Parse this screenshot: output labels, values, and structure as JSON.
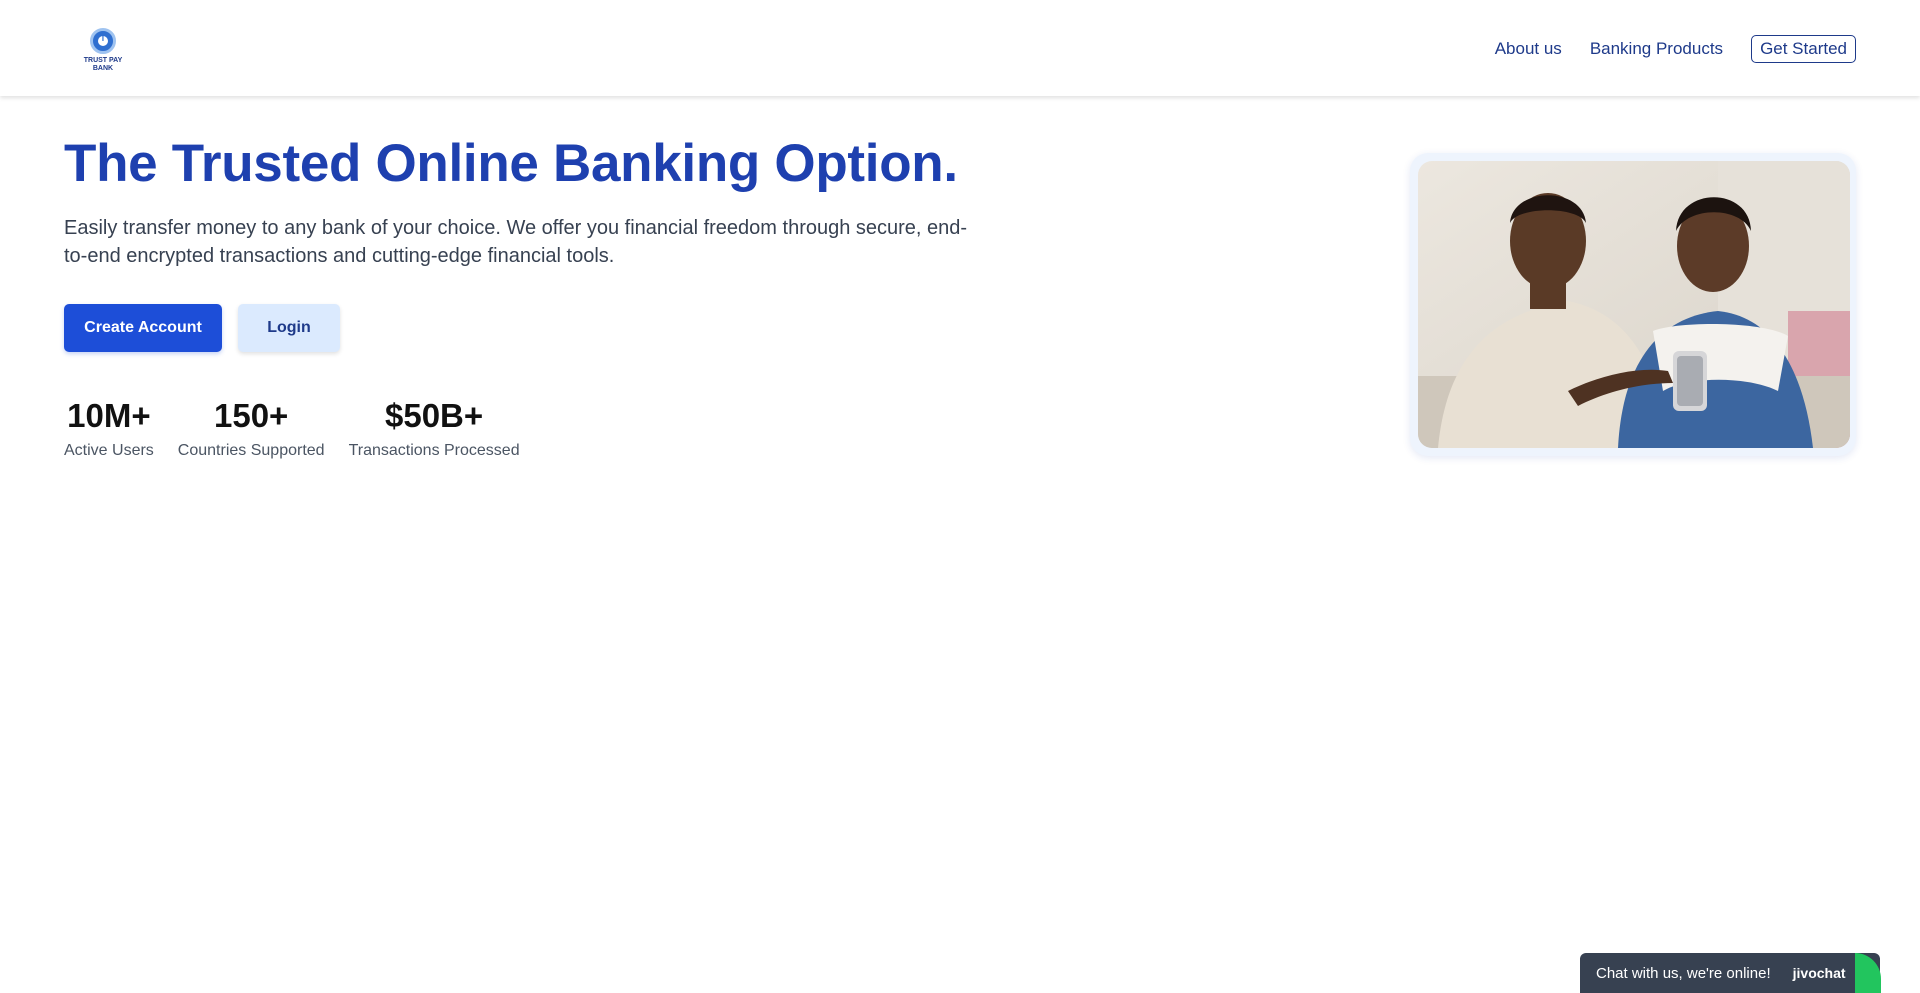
{
  "brand": {
    "name": "TRUST PAY BANK",
    "logo_letter": "T"
  },
  "nav": {
    "about": "About us",
    "products": "Banking Products",
    "get_started": "Get Started"
  },
  "hero": {
    "title": "The Trusted Online Banking Option.",
    "subtitle": "Easily transfer money to any bank of your choice. We offer you financial freedom through secure, end-to-end encrypted transactions and cutting-edge financial tools.",
    "primary_button": "Create Account",
    "secondary_button": "Login"
  },
  "stats": [
    {
      "value": "10M+",
      "label": "Active Users"
    },
    {
      "value": "150+",
      "label": "Countries Supported"
    },
    {
      "value": "$50B+",
      "label": "Transactions Processed"
    }
  ],
  "chat": {
    "text": "Chat with us, we're online!",
    "brand": "jivochat"
  },
  "colors": {
    "primary": "#1d4ed8",
    "heading": "#1e40af",
    "nav": "#1e3a8a",
    "secondary_bg": "#dbeafe",
    "chat_bg": "#374151",
    "chat_accent": "#22c55e"
  }
}
